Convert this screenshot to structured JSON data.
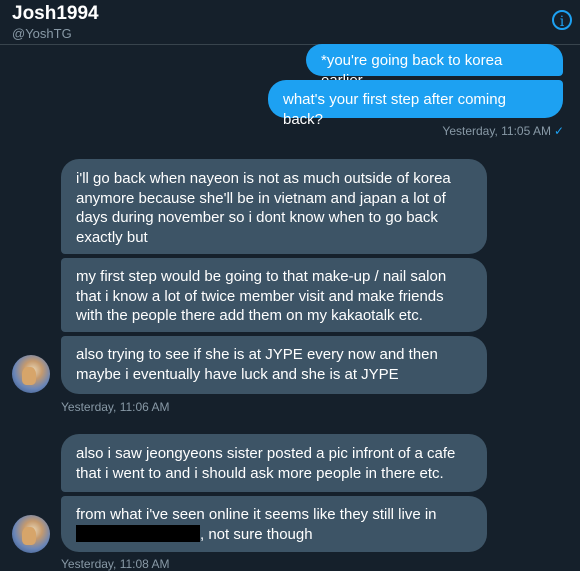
{
  "header": {
    "name": "Josh1994",
    "handle": "@YoshTG",
    "info_icon": "info-icon"
  },
  "sent_messages": [
    "*you're going back to korea earlier",
    "what's your first step after coming back?"
  ],
  "sent_meta": {
    "time": "Yesterday, 11:05 AM",
    "status_icon": "checkmark-icon",
    "status_glyph": "✓"
  },
  "received_group_1": [
    "i'll go back when nayeon is not as much outside of korea anymore because she'll be in vietnam and japan a lot of days during november so i dont know when to go back exactly but",
    "my first step would be going to that make-up / nail salon that i know a lot of twice member visit and make friends with the people there add them on my kakaotalk etc.",
    "also trying to see if she is at JYPE every now and then maybe i eventually have luck and she is at JYPE"
  ],
  "received_group_1_time": "Yesterday, 11:06 AM",
  "received_group_2": [
    "also i saw jeongyeons sister posted a pic infront of a cafe that i went to and i should ask more people in there etc.",
    "from what i've seen online it seems like they still live in",
    ", not sure though"
  ],
  "received_group_2_time": "Yesterday, 11:08 AM",
  "colors": {
    "background": "#15202b",
    "sent_bubble": "#1da1f2",
    "received_bubble": "#3d5466",
    "meta_text": "#8899a6"
  }
}
